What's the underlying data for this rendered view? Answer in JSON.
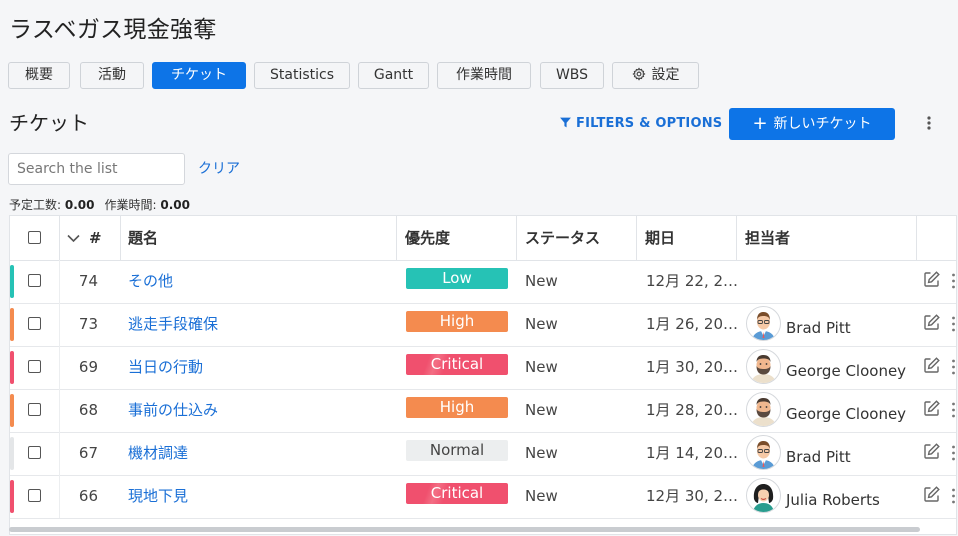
{
  "app": {
    "title": "ラスベガス現金強奪"
  },
  "tabs": [
    {
      "label": "概要"
    },
    {
      "label": "活動"
    },
    {
      "label": "チケット"
    },
    {
      "label": "Statistics"
    },
    {
      "label": "Gantt"
    },
    {
      "label": "作業時間"
    },
    {
      "label": "WBS"
    },
    {
      "label": "設定",
      "icon": "gear-icon"
    }
  ],
  "active_tab": "チケット",
  "section": {
    "title": "チケット",
    "filters_label": "FILTERS & OPTIONS",
    "new_button_label": "新しいチケット"
  },
  "search": {
    "placeholder": "Search the list",
    "value": "",
    "clear_label": "クリア"
  },
  "summary": {
    "estimated_label": "予定工数:",
    "estimated_value": "0.00",
    "spent_label": "作業時間:",
    "spent_value": "0.00"
  },
  "table": {
    "columns": {
      "id": "#",
      "subject": "題名",
      "priority": "優先度",
      "status": "ステータス",
      "due": "期日",
      "assignee": "担当者"
    },
    "rows": [
      {
        "id": "74",
        "subject": "その他",
        "priority": "Low",
        "status": "New",
        "due": "12月 22, 2…",
        "assignee": "",
        "avatar": "",
        "bar": "#26c2b5"
      },
      {
        "id": "73",
        "subject": "逃走手段確保",
        "priority": "High",
        "status": "New",
        "due": "1月 26, 20…",
        "assignee": "Brad Pitt",
        "avatar": "brad",
        "bar": "#f48b4f"
      },
      {
        "id": "69",
        "subject": "当日の行動",
        "priority": "Critical",
        "status": "New",
        "due": "1月 30, 20…",
        "assignee": "George Clooney",
        "avatar": "george",
        "bar": "#f0506e"
      },
      {
        "id": "68",
        "subject": "事前の仕込み",
        "priority": "High",
        "status": "New",
        "due": "1月 28, 20…",
        "assignee": "George Clooney",
        "avatar": "george",
        "bar": "#f48b4f"
      },
      {
        "id": "67",
        "subject": "機材調達",
        "priority": "Normal",
        "status": "New",
        "due": "1月 14, 20…",
        "assignee": "Brad Pitt",
        "avatar": "brad",
        "bar": "#e4e6e8"
      },
      {
        "id": "66",
        "subject": "現地下見",
        "priority": "Critical",
        "status": "New",
        "due": "12月 30, 2…",
        "assignee": "Julia Roberts",
        "avatar": "julia",
        "bar": "#f0506e"
      }
    ]
  },
  "colors": {
    "accent": "#0d74e7",
    "link": "#1a6fd6",
    "low": "#26c2b5",
    "high": "#f48b4f",
    "critical": "#f0506e",
    "normal": "#eceeef"
  }
}
